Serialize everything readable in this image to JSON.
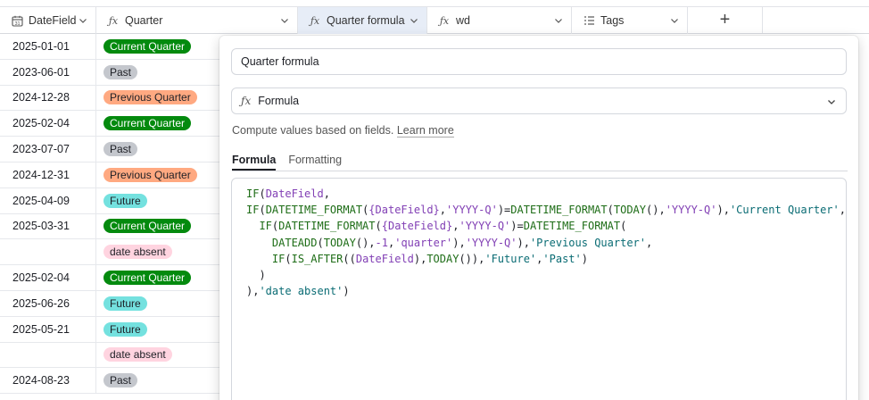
{
  "header": {
    "columns": [
      {
        "label": "DateField",
        "icon": "calendar-icon"
      },
      {
        "label": "Quarter",
        "icon": "formula-icon"
      },
      {
        "label": "Quarter formula",
        "icon": "formula-icon"
      },
      {
        "label": "wd",
        "icon": "formula-icon"
      },
      {
        "label": "Tags",
        "icon": "multiselect-icon"
      }
    ],
    "add_label": "+"
  },
  "rows": [
    {
      "date": "2025-01-01",
      "quarter": "Current Quarter"
    },
    {
      "date": "2023-06-01",
      "quarter": "Past"
    },
    {
      "date": "2024-12-28",
      "quarter": "Previous Quarter"
    },
    {
      "date": "2025-02-04",
      "quarter": "Current Quarter"
    },
    {
      "date": "2023-07-07",
      "quarter": "Past"
    },
    {
      "date": "2024-12-31",
      "quarter": "Previous Quarter"
    },
    {
      "date": "2025-04-09",
      "quarter": "Future"
    },
    {
      "date": "2025-03-31",
      "quarter": "Current Quarter"
    },
    {
      "date": "",
      "quarter": "date absent"
    },
    {
      "date": "2025-02-04",
      "quarter": "Current Quarter"
    },
    {
      "date": "2025-06-26",
      "quarter": "Future"
    },
    {
      "date": "2025-05-21",
      "quarter": "Future"
    },
    {
      "date": "",
      "quarter": "date absent"
    },
    {
      "date": "2024-08-23",
      "quarter": "Past"
    }
  ],
  "pill_colors": {
    "Current Quarter": "#048a0e",
    "Past": "#c4c7cd",
    "Previous Quarter": "#ffa981",
    "Future": "#74e1df",
    "date absent": "#ffd4e0"
  },
  "panel": {
    "field_name": "Quarter formula",
    "field_type": "Formula",
    "description": "Compute values based on fields.",
    "learn_more": "Learn more",
    "tabs": [
      {
        "label": "Formula",
        "active": true
      },
      {
        "label": "Formatting",
        "active": false
      }
    ],
    "formula_lines": [
      "IF(DateField,",
      "IF(DATETIME_FORMAT({DateField},'YYYY-Q')=DATETIME_FORMAT(TODAY(),'YYYY-Q'),'Current Quarter',",
      "  IF(DATETIME_FORMAT({DateField},'YYYY-Q')=DATETIME_FORMAT(",
      "    DATEADD(TODAY(),-1,'quarter'),'YYYY-Q'),'Previous Quarter',",
      "    IF(IS_AFTER((DateField),TODAY()),'Future','Past')",
      "  )",
      "),'date absent')"
    ]
  }
}
